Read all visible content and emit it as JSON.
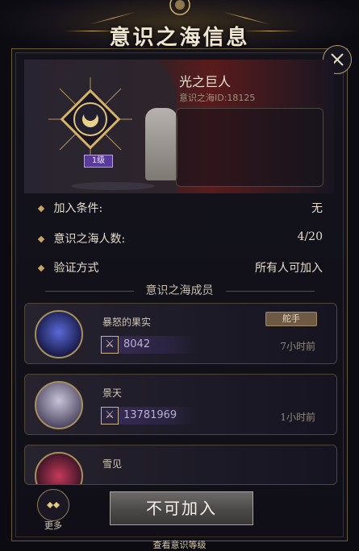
{
  "dialog": {
    "title": "意识之海信息"
  },
  "guild": {
    "name": "光之巨人",
    "id_label": "意识之海ID:18125",
    "level": "1级",
    "description": ""
  },
  "info": [
    {
      "label": "加入条件:",
      "value": "无"
    },
    {
      "label": "意识之海人数:",
      "value": "4/20"
    },
    {
      "label": "验证方式",
      "value": "所有人可加入"
    }
  ],
  "members_section_title": "意识之海成员",
  "members": [
    {
      "name": "暴怒的果实",
      "power": "8042",
      "time": "7小时前",
      "role": "舵手",
      "avatar_color": "#3b4aa0"
    },
    {
      "name": "景天",
      "power": "13781969",
      "time": "1小时前",
      "role": "",
      "avatar_color": "#6a6480"
    },
    {
      "name": "雪见",
      "power": "",
      "time": "",
      "role": "",
      "avatar_color": "#a02a4a"
    }
  ],
  "footer": {
    "more_label": "更多",
    "join_label": "不可加入",
    "bottom_text": "查看意识等级"
  },
  "colors": {
    "gold": "#c9a560",
    "purple_badge": "#5a3a9a"
  }
}
